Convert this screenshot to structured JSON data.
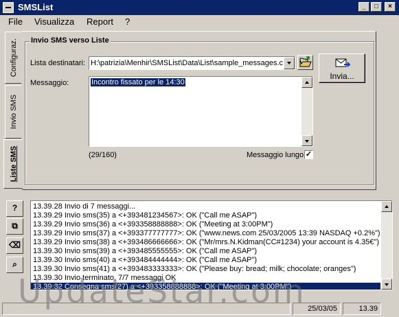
{
  "window": {
    "title": "SMSList"
  },
  "menu": [
    "File",
    "Visualizza",
    "Report",
    "?"
  ],
  "tabs": {
    "configuraz": "Configuraz.",
    "invio_sms": "Invio SMS",
    "liste_sms": "Liste SMS"
  },
  "form": {
    "group_title": "Invio SMS verso Liste",
    "dest_label": "Lista destinatari:",
    "dest_value": "H:\\patrizia\\Menhir\\SMSList\\Data\\List\\sample_messages.c",
    "send_label": "Invia...",
    "message_label": "Messaggio:",
    "message_value": "Incontro fissato per le 14:30",
    "char_count": "(29/160)",
    "long_message_label": "Messaggio lungo",
    "long_message_checked": true
  },
  "tools": [
    {
      "name": "help-icon",
      "glyph": "?"
    },
    {
      "name": "copy-icon",
      "glyph": "⧉"
    },
    {
      "name": "eraser-icon",
      "glyph": "⌫"
    },
    {
      "name": "preview-icon",
      "glyph": "⌕"
    }
  ],
  "log": [
    "13.39.28  Invio di 7 messaggi...",
    "13.39.29  Invio sms(35) a <+393481234567>: OK   (\"Call me ASAP\")",
    "13.39.29  Invio sms(36) a <+393358888888>: OK   (\"Meeting at 3:00PM\")",
    "13.39.29  Invio sms(37) a <+393377777777>: OK   (\"www.news.com 25/03/2005 13:39 NASDAQ +0.2%\")",
    "13.39.29  Invio sms(38) a <+393486666666>: OK   (\"Mr/mrs.N.Kidman(CC#1234) your account is 4.35€\")",
    "13.39.30  Invio sms(39) a <+393485555555>: OK   (\"Call me ASAP\")",
    "13.39.30  Invio sms(40) a <+393484444444>: OK   (\"Call me ASAP\")",
    "13.39.30  Invio sms(41) a <+393483333333>: OK   (\"Please buy: bread; milk; chocolate; oranges\")",
    "13.39.30  Invio terminato, 7/7 messaggi OK",
    "13.39.32  Consegna sms(27) a <+393358888888>: OK   (\"Meeting at 3:00PM\")"
  ],
  "log_selected_index": 9,
  "watermark": "UpdateStar.com",
  "status": {
    "date": "25/03/05",
    "time": "13.39"
  }
}
